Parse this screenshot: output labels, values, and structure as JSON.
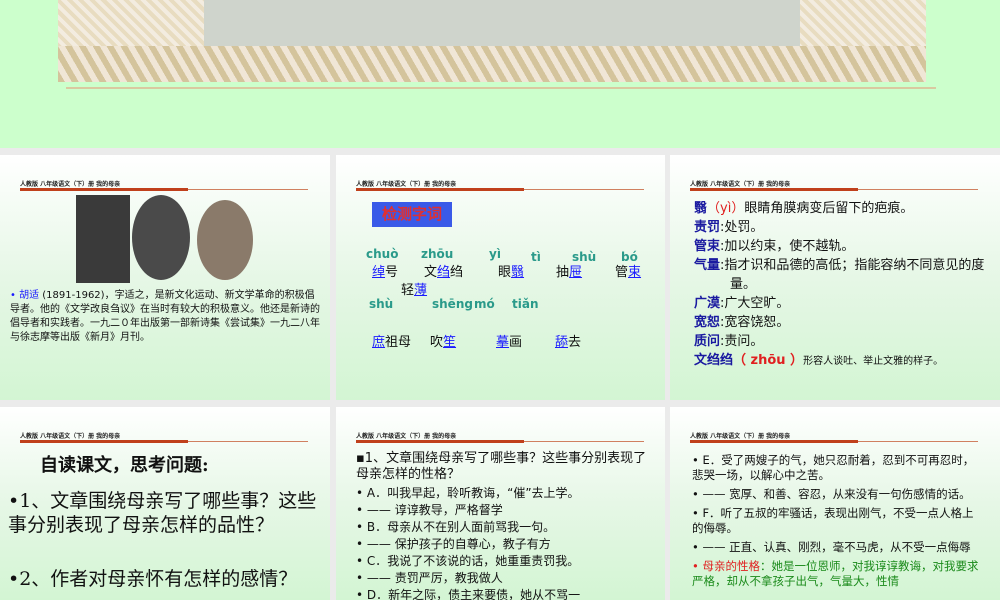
{
  "slide_header": "人教版  八年级语文（下）册   我的母亲",
  "slide1": {
    "name": "胡适",
    "text": " (1891-1962)，字适之，是新文化运动、新文学革命的积极倡导者。他的《文学改良刍议》在当时有较大的积极意义。他还是新诗的倡导者和实践者。一九二０年出版第一部新诗集《尝试集》一九二八年与徐志摩等出版《新月》月刊。"
  },
  "slide2": {
    "title": "检测字词",
    "pinyin_row1": [
      "chuò",
      "zhōu",
      "yì",
      "tì",
      "shù",
      "bó"
    ],
    "words_row1": [
      [
        "",
        "绰",
        "号"
      ],
      [
        "文",
        "绉",
        "绉"
      ],
      [
        "眼",
        "翳",
        ""
      ],
      [
        "抽",
        "屉",
        ""
      ],
      [
        "管",
        "束",
        ""
      ],
      [
        "轻",
        "薄",
        ""
      ]
    ],
    "pinyin_row2": [
      "shù",
      "shēng",
      "mó",
      "tiǎn"
    ],
    "words_row2": [
      [
        "",
        "庶",
        "祖母"
      ],
      [
        "吹",
        "笙",
        ""
      ],
      [
        "",
        "摹",
        "画"
      ],
      [
        "",
        "舔",
        "去"
      ]
    ]
  },
  "slide3": {
    "items": [
      {
        "term": "翳",
        "pin": "（yì）",
        "def": "眼睛角膜病变后留下的疤痕。"
      },
      {
        "term": "责罚",
        "def": ":处罚。"
      },
      {
        "term": "管束",
        "def": ":加以约束，使不越轨。"
      },
      {
        "term": "气量",
        "def": ":指才识和品德的高低；指能容纳不同意见的度量。"
      },
      {
        "term": "广漠",
        "def": ":广大空旷。"
      },
      {
        "term": "宽恕",
        "def": ":宽容饶恕。"
      },
      {
        "term": "质问",
        "def": ":责问。"
      },
      {
        "term": "文绉绉",
        "pin": "（ zhōu ）",
        "def": "形容人谈吐、举止文雅的样子。"
      }
    ]
  },
  "slide4": {
    "title": "自读课文，思考问题:",
    "q1": "•1、文章围绕母亲写了哪些事？这些事分别表现了母亲怎样的品性？",
    "q2": "•2、作者对母亲怀有怎样的感情？"
  },
  "slide5": {
    "lead": "▪1、文章围绕母亲写了哪些事？这些事分别表现了母亲怎样的性格？",
    "lines": [
      "• A．叫我早起，聆听教诲，“催”去上学。",
      "•          —— 谆谆教导，严格督学",
      "• B．母亲从不在别人面前骂我一句。",
      "•        —— 保护孩子的自尊心，教子有方",
      "• C．我说了不该说的话，她重重责罚我。",
      "•        —— 责罚严厉，教我做人",
      "• D．新年之际，债主来要债，她从不骂一"
    ]
  },
  "slide6": {
    "lines": [
      "• E．受了两嫂子的气，她只忍耐着，忍到不可再忍时，悲哭一场，以解心中之苦。",
      "• —— 宽厚、和善、容忍，从来没有一句伤感情的话。",
      "• F．听了五叔的牢骚话，表现出刚气，不受一点人格上的侮辱。",
      "• —— 正直、认真、刚烈，毫不马虎，从不受一点侮辱"
    ],
    "summary_label": "• 母亲的性格",
    "summary": "：她是一位恩师，对我谆谆教诲，对我要求严格，却从不拿孩子出气，气量大，性情"
  }
}
